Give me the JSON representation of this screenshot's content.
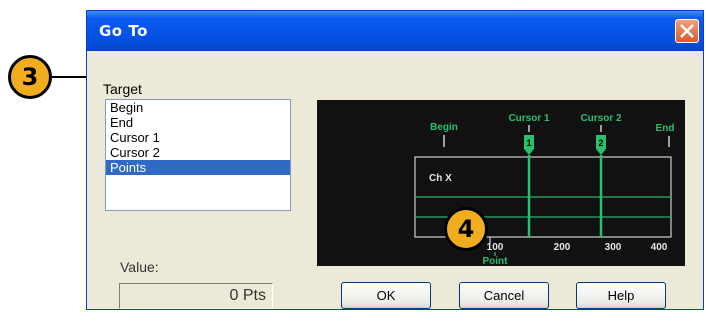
{
  "window": {
    "title": "Go To",
    "close_icon": "close-icon"
  },
  "target": {
    "label": "Target",
    "items": [
      "Begin",
      "End",
      "Cursor 1",
      "Cursor 2",
      "Points"
    ],
    "selected_index": 4
  },
  "preview": {
    "markers": {
      "begin": "Begin",
      "cursor1": "Cursor 1",
      "cursor2": "Cursor 2",
      "end": "End"
    },
    "cursor1_badge": "1",
    "cursor2_badge": "2",
    "channel": "Ch X",
    "ticks": [
      "100",
      "200",
      "300",
      "400"
    ],
    "axis_label": "Point"
  },
  "value": {
    "label": "Value:",
    "field": "0 Pts"
  },
  "buttons": {
    "ok": "OK",
    "cancel": "Cancel",
    "help": "Help"
  },
  "callouts": {
    "target": "3",
    "ok": "4"
  },
  "colors": {
    "title_bar": "#0550e3",
    "accent_green": "#28c06a",
    "callout": "#f0ad1d",
    "selection": "#316ac5"
  }
}
